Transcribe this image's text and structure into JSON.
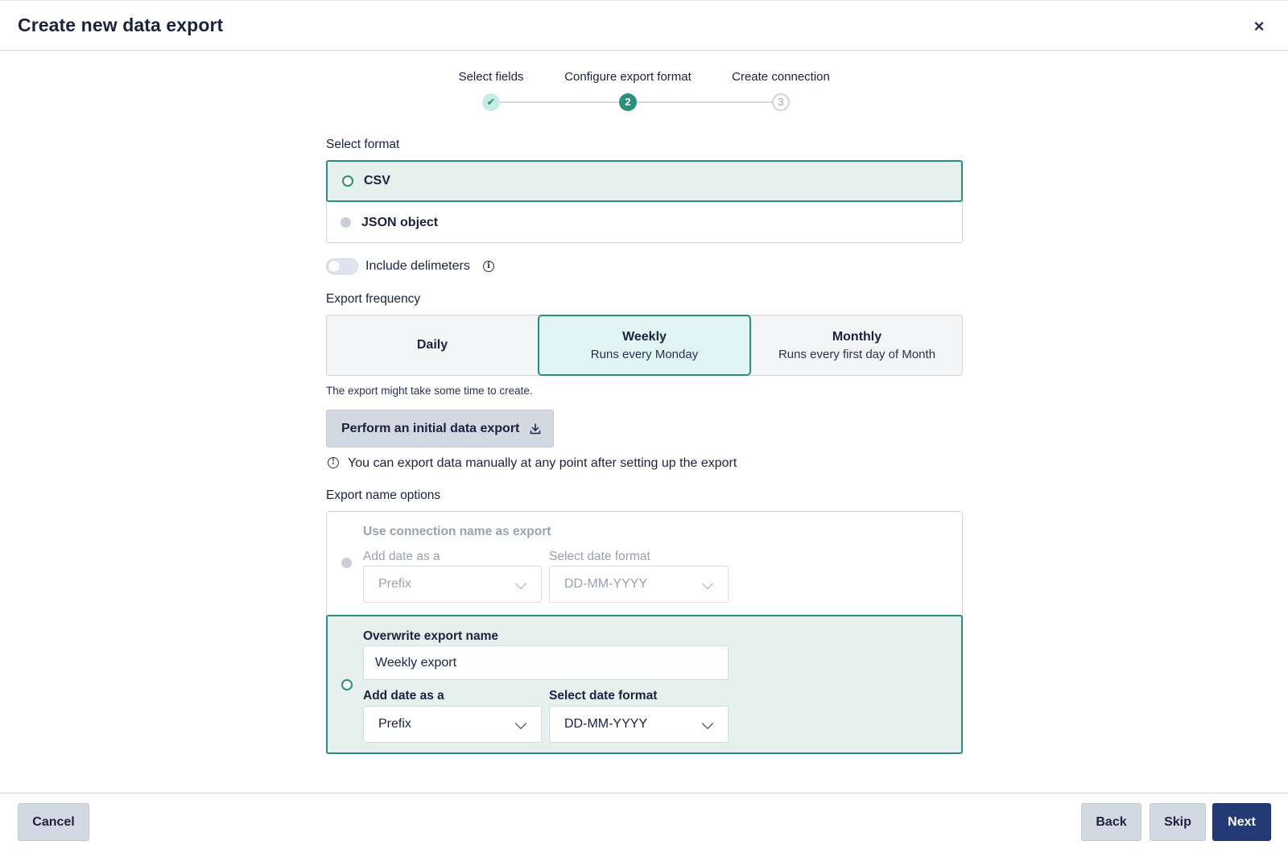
{
  "dialog": {
    "title": "Create new data export"
  },
  "steps": [
    {
      "label": "Select fields",
      "marker": "✔",
      "state": "done"
    },
    {
      "label": "Configure export format",
      "marker": "2",
      "state": "active"
    },
    {
      "label": "Create connection",
      "marker": "3",
      "state": "todo"
    }
  ],
  "format": {
    "label": "Select format",
    "options": [
      {
        "label": "CSV",
        "selected": true
      },
      {
        "label": "JSON object",
        "selected": false
      }
    ],
    "delimiters": {
      "label": "Include delimeters",
      "enabled": false
    }
  },
  "frequency": {
    "label": "Export frequency",
    "options": [
      {
        "title": "Daily",
        "subtitle": ""
      },
      {
        "title": "Weekly",
        "subtitle": "Runs every Monday",
        "selected": true
      },
      {
        "title": "Monthly",
        "subtitle": "Runs every first day of Month"
      }
    ],
    "note": "The export might take some time to create."
  },
  "initial_export": {
    "button_label": "Perform an initial data export",
    "hint": "You can export data manually at any point after setting up the export"
  },
  "name_options": {
    "label": "Export name options",
    "connection_option": {
      "title": "Use connection name as export",
      "date_position_label": "Add date as a",
      "date_position_value": "Prefix",
      "date_format_label": "Select date format",
      "date_format_value": "DD-MM-YYYY"
    },
    "overwrite_option": {
      "title": "Overwrite export name",
      "name_value": "Weekly export",
      "date_position_label": "Add date as a",
      "date_position_value": "Prefix",
      "date_format_label": "Select date format",
      "date_format_value": "DD-MM-YYYY",
      "selected": true
    }
  },
  "footer": {
    "cancel": "Cancel",
    "back": "Back",
    "skip": "Skip",
    "next": "Next"
  },
  "colors": {
    "accent": "#2a8f7e",
    "primary": "#233a74",
    "selected_bg": "#e6f1ee"
  }
}
